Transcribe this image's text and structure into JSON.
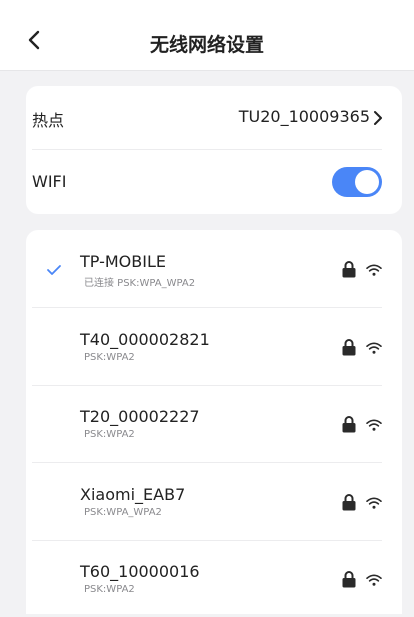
{
  "header": {
    "title": "无线网络设置",
    "back_icon": "chevron-left-icon"
  },
  "settings": {
    "hotspot_label": "热点",
    "hotspot_value": "TU20_10009365",
    "wifi_label": "WIFI",
    "wifi_enabled": true,
    "accent_color": "#4a86f7"
  },
  "networks": [
    {
      "name": "TP-MOBILE",
      "status": "已连接 PSK:WPA_WPA2",
      "connected": true
    },
    {
      "name": "T40_000002821",
      "status": "PSK:WPA2",
      "connected": false
    },
    {
      "name": "T20_00002227",
      "status": "PSK:WPA2",
      "connected": false
    },
    {
      "name": "Xiaomi_EAB7",
      "status": "PSK:WPA_WPA2",
      "connected": false
    },
    {
      "name": "T60_10000016",
      "status": "PSK:WPA2",
      "connected": false
    }
  ]
}
